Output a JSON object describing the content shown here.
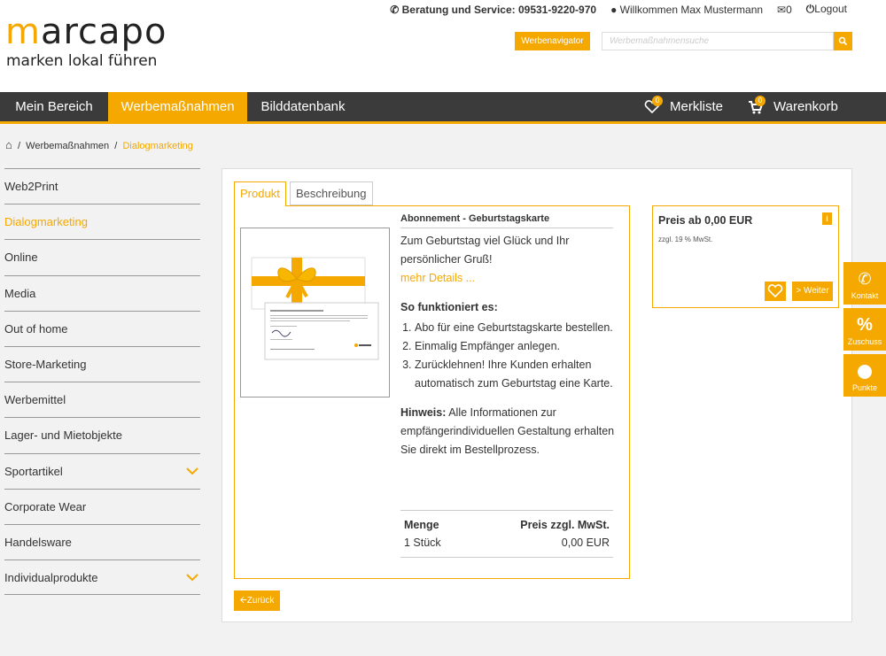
{
  "header": {
    "logo_word": "marcapo",
    "logo_tagline": "marken lokal führen",
    "service": "Beratung und Service: 09531-9220-970",
    "welcome": "Willkommen Max Mustermann",
    "mail_count": "0",
    "logout": "Logout",
    "werbenavigator": "Werbenavigator",
    "search_placeholder": "Werbemaßnahmensuche"
  },
  "nav": {
    "items": [
      {
        "label": "Mein Bereich"
      },
      {
        "label": "Werbemaßnahmen"
      },
      {
        "label": "Bilddatenbank"
      }
    ],
    "merkliste": "Merkliste",
    "merkliste_count": "0",
    "warenkorb": "Warenkorb",
    "warenkorb_count": "0"
  },
  "breadcrumb": {
    "level1": "Werbemaßnahmen",
    "level2": "Dialogmarketing",
    "sep": "/"
  },
  "sidebar": {
    "items": [
      {
        "label": "Web2Print"
      },
      {
        "label": "Dialogmarketing"
      },
      {
        "label": "Online"
      },
      {
        "label": "Media"
      },
      {
        "label": "Out of home"
      },
      {
        "label": "Store-Marketing"
      },
      {
        "label": "Werbemittel"
      },
      {
        "label": "Lager- und Mietobjekte"
      },
      {
        "label": "Sportartikel"
      },
      {
        "label": "Corporate Wear"
      },
      {
        "label": "Handelsware"
      },
      {
        "label": "Individualprodukte"
      }
    ]
  },
  "tabs": {
    "produkt": "Produkt",
    "beschreibung": "Beschreibung"
  },
  "product": {
    "title": "Abonnement - Geburtstagskarte",
    "tagline": "Zum Geburtstag viel Glück und Ihr persönlicher Gruß!",
    "more": "mehr Details ...",
    "how_heading": "So funktioniert es:",
    "steps": [
      "Abo für eine Geburtstagskarte bestellen.",
      "Einmalig Empfänger anlegen.",
      "Zurücklehnen! Ihre Kunden erhalten automatisch zum Geburtstag eine Karte."
    ],
    "hint_label": "Hinweis:",
    "hint_text": "Alle Informationen zur empfängerindividuellen Gestaltung erhalten Sie direkt im Bestellprozess.",
    "qty_header": "Menge",
    "price_header": "Preis zzgl. MwSt.",
    "qty_value": "1 Stück",
    "price_value": "0,00 EUR"
  },
  "price_box": {
    "price": "Preis ab 0,00 EUR",
    "mwst": "zzgl. 19 % MwSt.",
    "info": "i",
    "weiter": "> Weiter"
  },
  "back": "Zurück",
  "float": {
    "kontakt": "Kontakt",
    "zuschuss": "Zuschuss",
    "punkte": "Punkte"
  },
  "colors": {
    "accent": "#f5a800",
    "nav_bg": "#3b3b3b"
  }
}
